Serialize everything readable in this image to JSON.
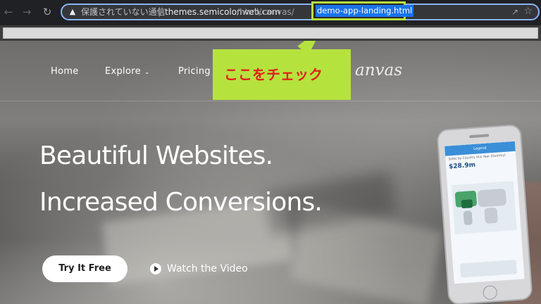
{
  "browser": {
    "security_label": "保護されていない通信",
    "url_host": "themes.semicolonweb.com",
    "url_path": "/html/canvas/",
    "url_highlight": "demo-app-landing.html"
  },
  "nav": {
    "home": "Home",
    "explore": "Explore",
    "pricing": "Pricing",
    "logo": "anvas"
  },
  "callout": {
    "text": "ここをチェック"
  },
  "hero": {
    "headline_1": "Beautiful Websites.",
    "headline_2": "Increased Conversions.",
    "cta_primary": "Try It Free",
    "cta_video": "Watch the Video"
  },
  "phone_screen": {
    "header": "Legend",
    "subtitle": "Sales by Country this Year (Dummy)",
    "amount": "$28.9m"
  },
  "colors": {
    "highlight": "#b6e23e",
    "callout_text": "#e0221b",
    "selection": "#1a73e8"
  }
}
